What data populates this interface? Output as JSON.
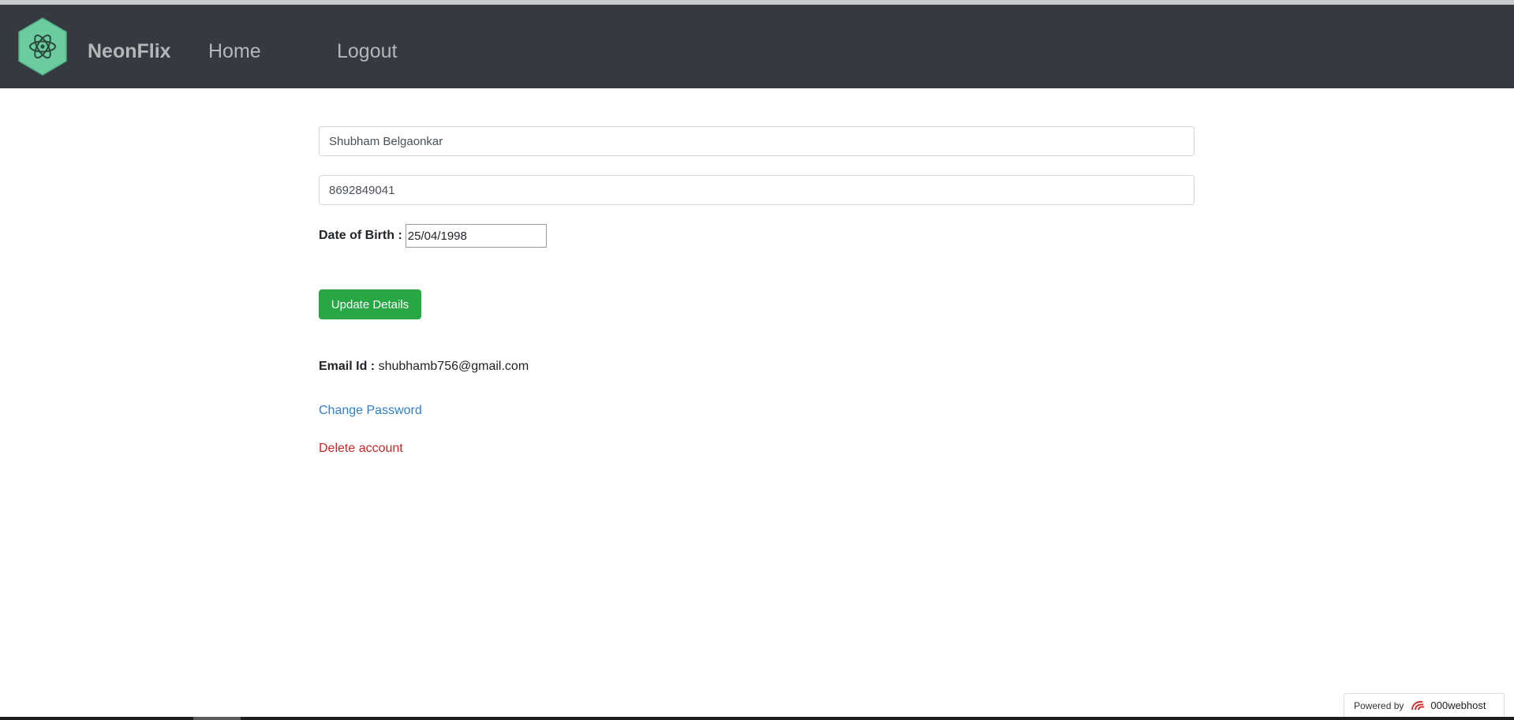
{
  "header": {
    "brand": "NeonFlix",
    "nav": {
      "home": "Home",
      "logout": "Logout"
    },
    "logo_icon": "atom-hexagon-icon"
  },
  "form": {
    "name_value": "Shubham Belgaonkar",
    "phone_value": "8692849041",
    "dob_label": "Date of Birth :",
    "dob_value": "25/04/1998",
    "update_button": "Update Details"
  },
  "account": {
    "email_label": "Email Id :",
    "email_value": "shubhamb756@gmail.com",
    "change_password": "Change Password",
    "delete_account": "Delete account"
  },
  "footer": {
    "powered_by": "Powered by",
    "host_name": "000webhost"
  },
  "colors": {
    "navbar": "#343a40",
    "logo_green": "#6ccca0",
    "button_green": "#28a745",
    "link_blue": "#2f7fc6",
    "danger_red": "#c62828"
  }
}
